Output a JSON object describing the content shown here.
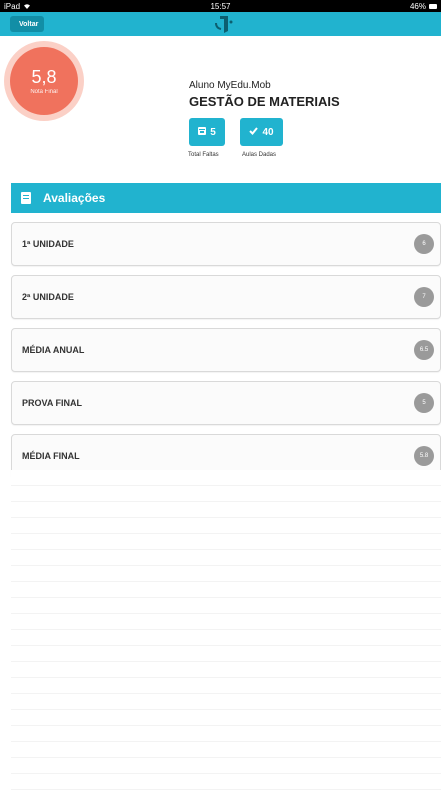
{
  "status_bar": {
    "carrier": "iPad",
    "time": "15:57",
    "battery": "46%"
  },
  "topbar": {
    "back_label": "Voltar",
    "logo_icon": "myedu-logo-icon"
  },
  "student": {
    "name": "Aluno MyEdu.Mob",
    "course": "GESTÃO DE MATERIAIS",
    "final_grade": "5,8",
    "final_grade_label": "Nota Final",
    "total_faltas": "5",
    "total_faltas_label": "Total Faltas",
    "aulas_dadas": "40",
    "aulas_dadas_label": "Aulas Dadas"
  },
  "section": {
    "title": "Avaliações"
  },
  "evaluations": [
    {
      "label": "1ª UNIDADE",
      "value": "6"
    },
    {
      "label": "2ª UNIDADE",
      "value": "7"
    },
    {
      "label": "MÉDIA ANUAL",
      "value": "6.5"
    },
    {
      "label": "PROVA FINAL",
      "value": "5"
    },
    {
      "label": "MÉDIA FINAL",
      "value": "5.8"
    }
  ],
  "colors": {
    "primary": "#21b3cf",
    "grade_circle": "#f0725d",
    "badge": "#9a9a9a"
  }
}
